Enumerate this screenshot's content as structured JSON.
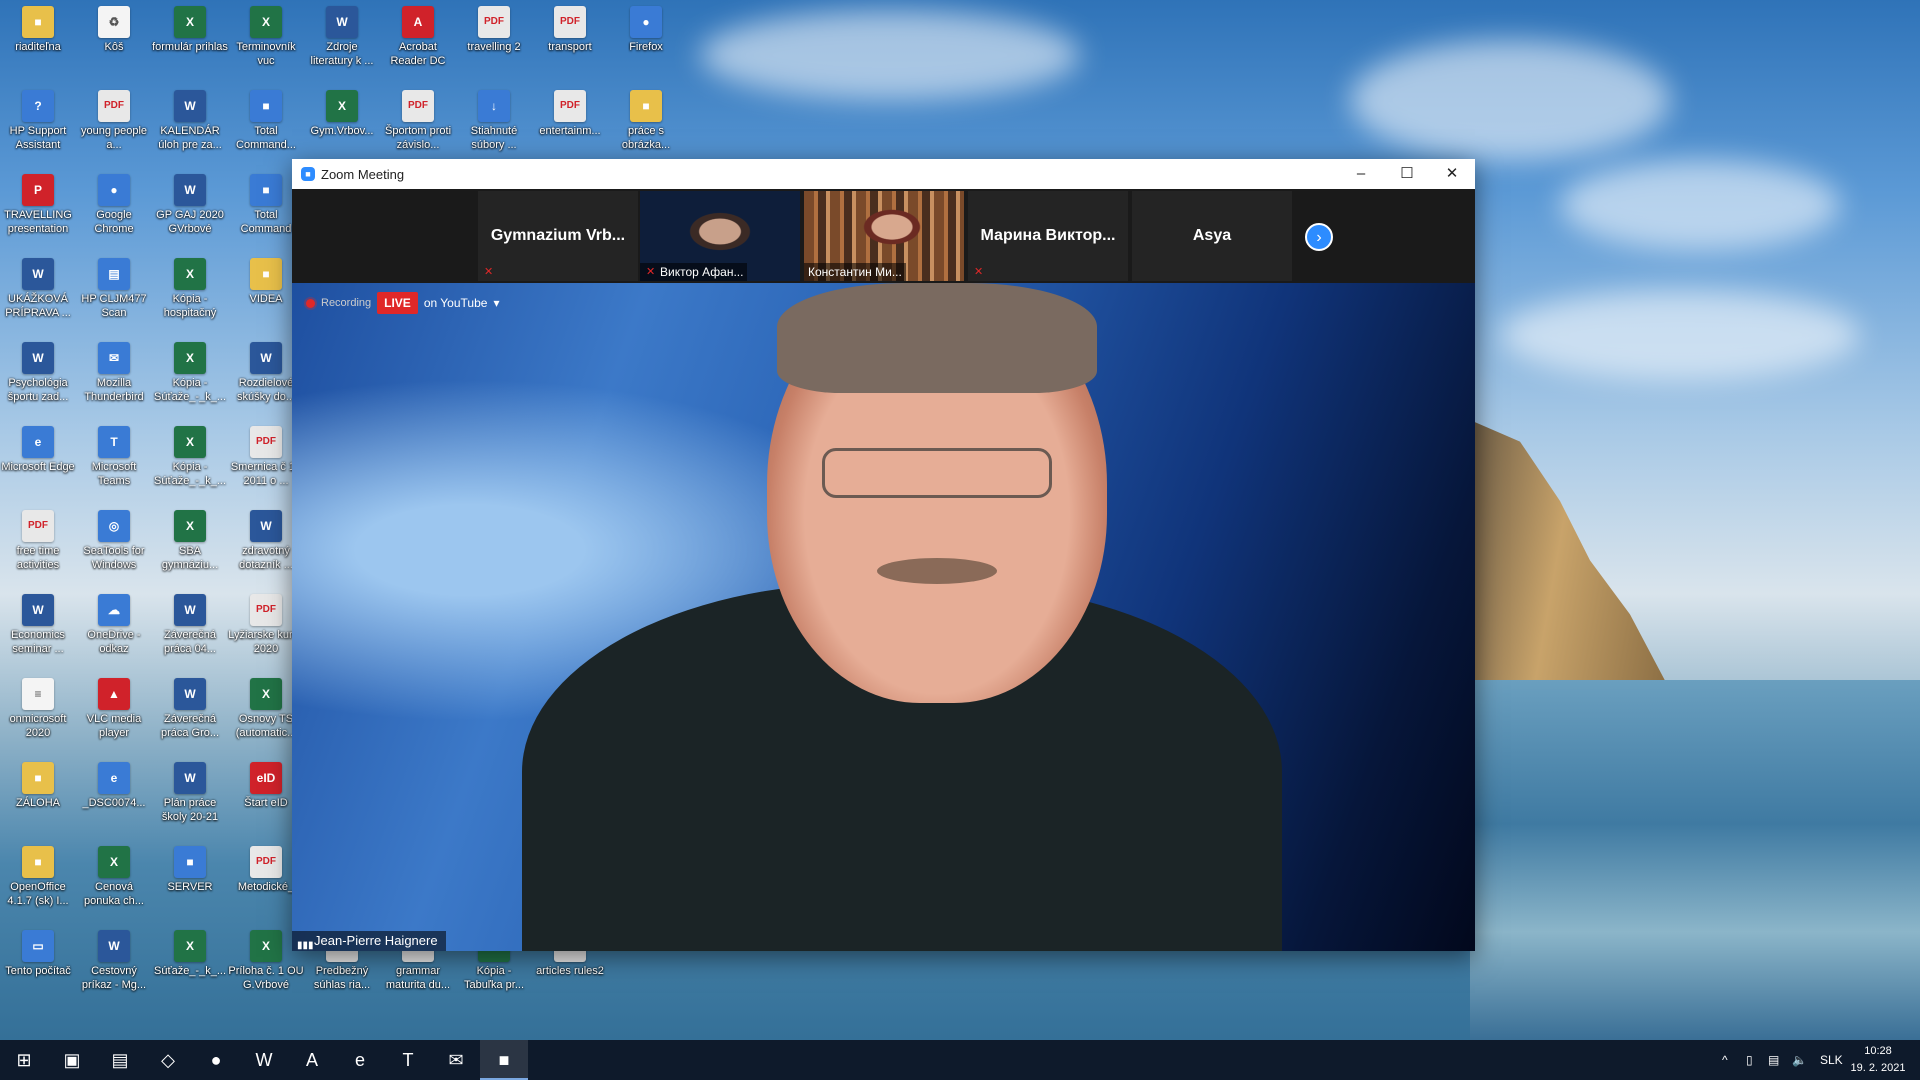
{
  "desktop": {
    "icons": [
      {
        "label": "riaditeľna",
        "glyph": "■",
        "kind": "folder"
      },
      {
        "label": "Kôš",
        "glyph": "♻",
        "kind": "doc"
      },
      {
        "label": "formulár prihlas",
        "glyph": "X",
        "kind": "excel"
      },
      {
        "label": "Terminovník vuc",
        "glyph": "X",
        "kind": "excel"
      },
      {
        "label": "Zdroje literatury k ...",
        "glyph": "W",
        "kind": "word"
      },
      {
        "label": "Acrobat Reader DC",
        "glyph": "A",
        "kind": "red"
      },
      {
        "label": "travelling 2",
        "glyph": "PDF",
        "kind": "pdf"
      },
      {
        "label": "transport",
        "glyph": "PDF",
        "kind": "pdf"
      },
      {
        "label": "Firefox",
        "glyph": "●",
        "kind": "app"
      },
      {
        "label": "HP Support Assistant",
        "glyph": "?",
        "kind": "app"
      },
      {
        "label": "young people a...",
        "glyph": "PDF",
        "kind": "pdf"
      },
      {
        "label": "KALENDÁR úloh pre za...",
        "glyph": "W",
        "kind": "word"
      },
      {
        "label": "Total Command...",
        "glyph": "■",
        "kind": "app"
      },
      {
        "label": "Gym.Vrbov...",
        "glyph": "X",
        "kind": "excel"
      },
      {
        "label": "Športom proti závislo...",
        "glyph": "PDF",
        "kind": "pdf"
      },
      {
        "label": "Stiahnuté súbory ...",
        "glyph": "↓",
        "kind": "app"
      },
      {
        "label": "entertainm...",
        "glyph": "PDF",
        "kind": "pdf"
      },
      {
        "label": "práce s obrázka...",
        "glyph": "■",
        "kind": "folder"
      },
      {
        "label": "TRAVELLING presentation",
        "glyph": "P",
        "kind": "red"
      },
      {
        "label": "Google Chrome",
        "glyph": "●",
        "kind": "app"
      },
      {
        "label": "GP GAJ 2020 GVrbové",
        "glyph": "W",
        "kind": "word"
      },
      {
        "label": "Total Command",
        "glyph": "■",
        "kind": "app"
      },
      {
        "label": "UKÁŽKOVÁ PRÍPRAVA ...",
        "glyph": "W",
        "kind": "word"
      },
      {
        "label": "HP CLJM477 Scan",
        "glyph": "▤",
        "kind": "app"
      },
      {
        "label": "Kópia - hospitačný",
        "glyph": "X",
        "kind": "excel"
      },
      {
        "label": "VIDEA",
        "glyph": "■",
        "kind": "folder"
      },
      {
        "label": "Psychológia športu zad...",
        "glyph": "W",
        "kind": "word"
      },
      {
        "label": "Mozilla Thunderbird",
        "glyph": "✉",
        "kind": "app"
      },
      {
        "label": "Kópia - Súťaže_-_k_...",
        "glyph": "X",
        "kind": "excel"
      },
      {
        "label": "Rozdielové skúšky do...",
        "glyph": "W",
        "kind": "word"
      },
      {
        "label": "Microsoft Edge",
        "glyph": "e",
        "kind": "app"
      },
      {
        "label": "Microsoft Teams",
        "glyph": "T",
        "kind": "app"
      },
      {
        "label": "Kópia - Súťaže_-_k_...",
        "glyph": "X",
        "kind": "excel"
      },
      {
        "label": "Smernica č 12 2011 o ...",
        "glyph": "PDF",
        "kind": "pdf"
      },
      {
        "label": "free time activities",
        "glyph": "PDF",
        "kind": "pdf"
      },
      {
        "label": "SeaTools for Windows",
        "glyph": "◎",
        "kind": "app"
      },
      {
        "label": "SBA gymnáziu...",
        "glyph": "X",
        "kind": "excel"
      },
      {
        "label": "zdravotný dotazník ...",
        "glyph": "W",
        "kind": "word"
      },
      {
        "label": "Economics seminar ...",
        "glyph": "W",
        "kind": "word"
      },
      {
        "label": "OneDrive - odkaz",
        "glyph": "☁",
        "kind": "app"
      },
      {
        "label": "Záverečná práca 04...",
        "glyph": "W",
        "kind": "word"
      },
      {
        "label": "Lyžiarske kurzy 2020",
        "glyph": "PDF",
        "kind": "pdf"
      },
      {
        "label": "onmicrosoft 2020",
        "glyph": "≡",
        "kind": "doc"
      },
      {
        "label": "VLC media player",
        "glyph": "▲",
        "kind": "red"
      },
      {
        "label": "Záverečná práca Gro...",
        "glyph": "W",
        "kind": "word"
      },
      {
        "label": "Osnovy TS (automatic...",
        "glyph": "X",
        "kind": "excel"
      },
      {
        "label": "ZÁLOHA",
        "glyph": "■",
        "kind": "folder"
      },
      {
        "label": "_DSC0074...",
        "glyph": "e",
        "kind": "app"
      },
      {
        "label": "Plán práce školy 20-21",
        "glyph": "W",
        "kind": "word"
      },
      {
        "label": "Štart eID",
        "glyph": "eID",
        "kind": "red"
      },
      {
        "label": "OpenOffice 4.1.7 (sk) I...",
        "glyph": "■",
        "kind": "folder"
      },
      {
        "label": "Cenová ponuka ch...",
        "glyph": "X",
        "kind": "excel"
      },
      {
        "label": "SERVER",
        "glyph": "■",
        "kind": "app"
      },
      {
        "label": "Metodické_",
        "glyph": "PDF",
        "kind": "pdf"
      },
      {
        "label": "Tento počítač",
        "glyph": "▭",
        "kind": "app"
      },
      {
        "label": "Cestovný príkaz - Mg...",
        "glyph": "W",
        "kind": "word"
      },
      {
        "label": "Súťaže_-_k_...",
        "glyph": "X",
        "kind": "excel"
      },
      {
        "label": "Príloha č. 1 OU G.Vrbové",
        "glyph": "X",
        "kind": "excel"
      },
      {
        "label": "Predbežný súhlas ria...",
        "glyph": "PDF",
        "kind": "pdf"
      },
      {
        "label": "grammar maturita du...",
        "glyph": "PDF",
        "kind": "pdf"
      },
      {
        "label": "Kópia - Tabuľka pr...",
        "glyph": "X",
        "kind": "excel"
      },
      {
        "label": "articles rules2",
        "glyph": "PDF",
        "kind": "pdf"
      }
    ]
  },
  "zoom": {
    "window_title": "Zoom Meeting",
    "minimize": "–",
    "maximize": "☐",
    "close": "✕",
    "participants": [
      {
        "name": "Gymnazium  Vrb...",
        "video": false,
        "muted": true
      },
      {
        "name": "Виктор Афан...",
        "video": true,
        "muted": true
      },
      {
        "name": "Константин Ми...",
        "video": true,
        "muted": false
      },
      {
        "name": "Марина  Виктор...",
        "video": false,
        "muted": true
      },
      {
        "name": "Asya",
        "video": false,
        "muted": false
      }
    ],
    "next_icon": "›",
    "recording_label": "Recording",
    "live_label": "LIVE",
    "stream_label": "on YouTube",
    "dropdown_icon": "▾",
    "speaker_name": "Jean-Pierre Haignere"
  },
  "taskbar": {
    "apps": [
      "⊞",
      "▣",
      "▤",
      "◇",
      "●",
      "W",
      "A",
      "e",
      "T",
      "✉",
      "■"
    ],
    "tray_chevron": "^",
    "language": "SLK",
    "time": "10:28",
    "date": "19. 2. 2021"
  }
}
